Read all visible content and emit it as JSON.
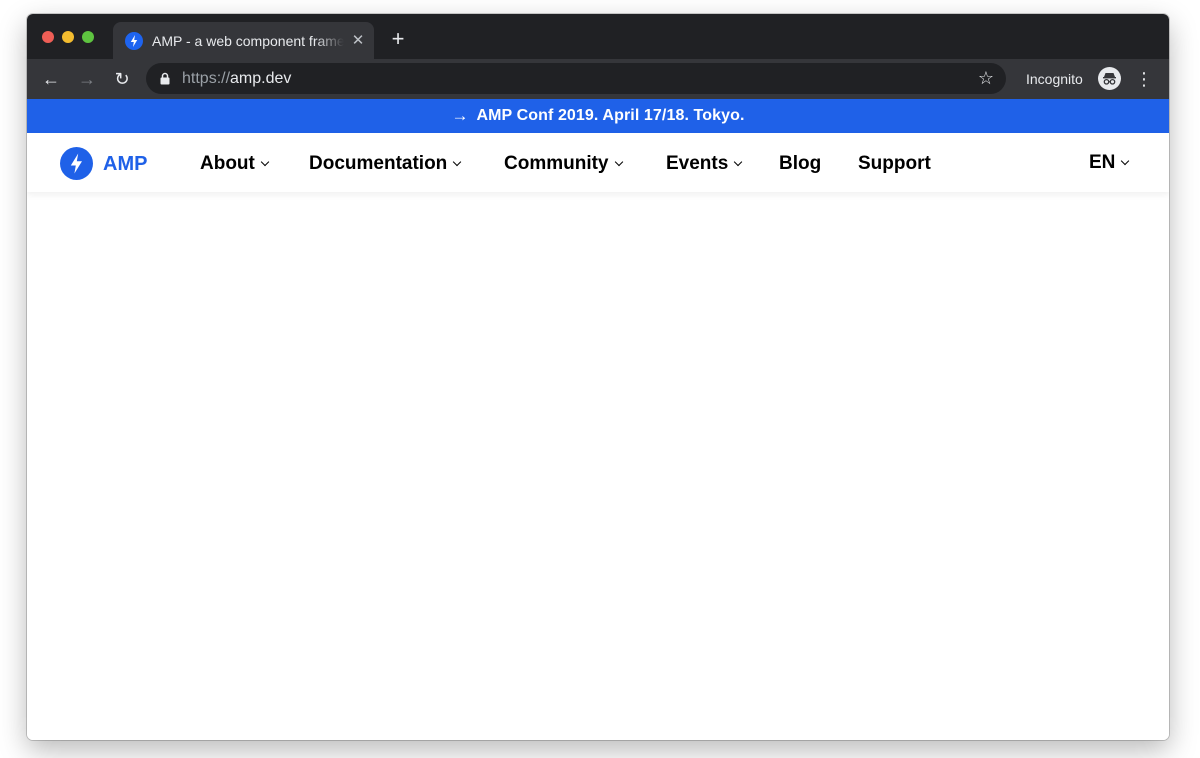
{
  "browser": {
    "tab": {
      "title": "AMP - a web component framework",
      "close_icon": "close-icon",
      "favicon": "amp-bolt-icon"
    },
    "new_tab_icon": "plus-icon",
    "toolbar": {
      "back_icon": "arrow-left-icon",
      "forward_icon": "arrow-right-icon",
      "reload_icon": "reload-icon",
      "url_scheme": "https://",
      "url_host": "amp.dev",
      "bookmark_icon": "star-icon",
      "incognito_label": "Incognito",
      "incognito_icon": "incognito-icon",
      "menu_icon": "kebab-menu-icon"
    }
  },
  "site": {
    "banner": {
      "arrow": "→",
      "text": "AMP Conf 2019. April 17/18. Tokyo."
    },
    "logo": {
      "text": "AMP",
      "icon": "amp-bolt-icon"
    },
    "nav": [
      {
        "label": "About",
        "dropdown": true
      },
      {
        "label": "Documentation",
        "dropdown": true
      },
      {
        "label": "Community",
        "dropdown": true
      },
      {
        "label": "Events",
        "dropdown": true
      },
      {
        "label": "Blog",
        "dropdown": false
      },
      {
        "label": "Support",
        "dropdown": false
      }
    ],
    "language": {
      "label": "EN",
      "dropdown": true
    }
  },
  "colors": {
    "brand_blue": "#1f61e8",
    "tabstrip": "#202124",
    "toolbar": "#35363a"
  }
}
